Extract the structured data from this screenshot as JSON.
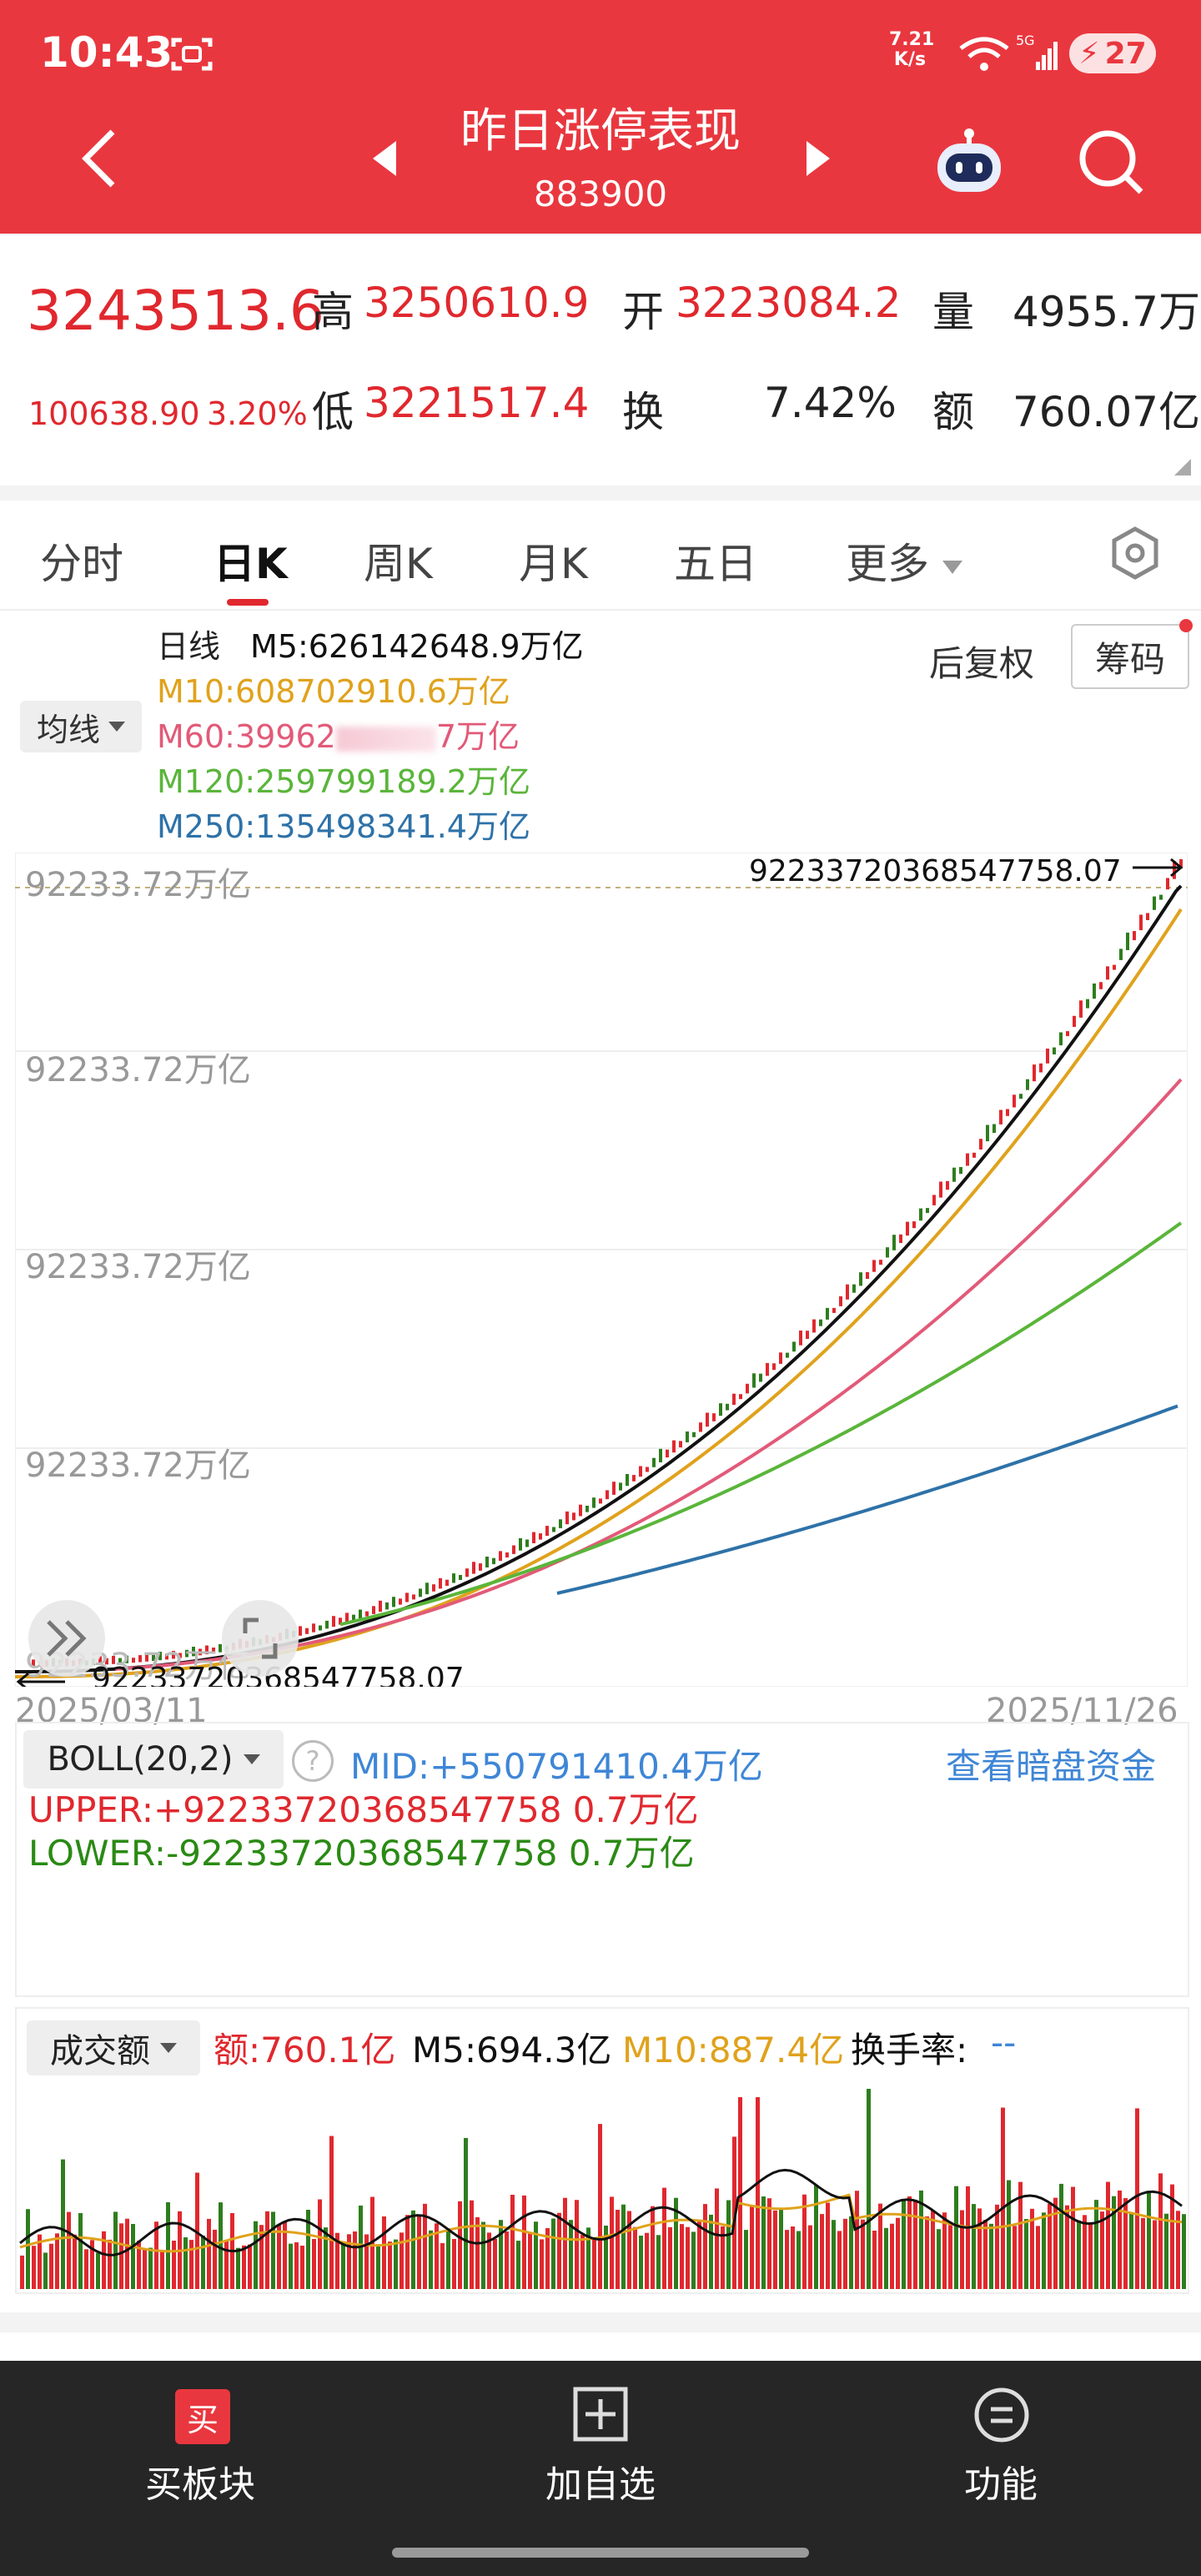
{
  "status": {
    "time": "10:43",
    "net_speed_value": "7.21",
    "net_speed_unit": "K/s",
    "battery": "27"
  },
  "nav": {
    "title": "昨日涨停表现",
    "code": "883900"
  },
  "quote": {
    "price": "3243513.6",
    "change": "100638.90",
    "change_pct": "3.20%",
    "high_label": "高",
    "high": "3250610.9",
    "low_label": "低",
    "low": "3221517.4",
    "open_label": "开",
    "open": "3223084.2",
    "turnover_label": "换",
    "turnover": "7.42%",
    "volume_label": "量",
    "volume": "4955.7万",
    "amount_label": "额",
    "amount": "760.07亿"
  },
  "tabs": [
    "分时",
    "日K",
    "周K",
    "月K",
    "五日",
    "更多"
  ],
  "chart_header": {
    "period": "日线",
    "ma_select": "均线",
    "ma5": "M5:626142648.9万亿",
    "ma10": "M10:608702910.6万亿",
    "ma60": "M60:39962",
    "ma60_tail": "7万亿",
    "ma120": "M120:259799189.2万亿",
    "ma250": "M250:135498341.4万亿",
    "restore": "后复权",
    "chips": "筹码"
  },
  "colors": {
    "red": "#e0282e",
    "ma5": "#111111",
    "ma10": "#e0a21c",
    "ma60": "#e25a78",
    "ma120": "#5ab53a",
    "ma250": "#2e72a8",
    "green": "#2e7d1e"
  },
  "chart_data": {
    "type": "line",
    "y_tick_labels": [
      "92233.72万亿",
      "92233.72万亿",
      "92233.72万亿",
      "92233.72万亿",
      "92233.72万亿"
    ],
    "max_label": "92233720368547758.07",
    "min_label": "92233720368547758.07",
    "x_start": "2025/03/11",
    "x_end": "2025/11/26",
    "series": [
      {
        "name": "M5"
      },
      {
        "name": "M10"
      },
      {
        "name": "M60"
      },
      {
        "name": "M120"
      },
      {
        "name": "M250"
      }
    ]
  },
  "boll": {
    "select": "BOLL(20,2)",
    "mid": "MID:+550791410.4万亿",
    "upper": "UPPER:+92233720368547758 0.7万亿",
    "upper_text": "UPPER:+92233720368547758 0.7万亿",
    "lower_text": "LOWER:-92233720368547758 0.7万亿",
    "link": "查看暗盘资金"
  },
  "volume_panel": {
    "select": "成交额",
    "amount": "额:760.1亿",
    "m5": "M5:694.3亿",
    "m10": "M10:887.4亿",
    "turnover": "换手率:",
    "turnover_value": "--"
  },
  "bottom_bar": {
    "buy": "买板块",
    "buy_icon": "买",
    "add": "加自选",
    "func": "功能"
  }
}
